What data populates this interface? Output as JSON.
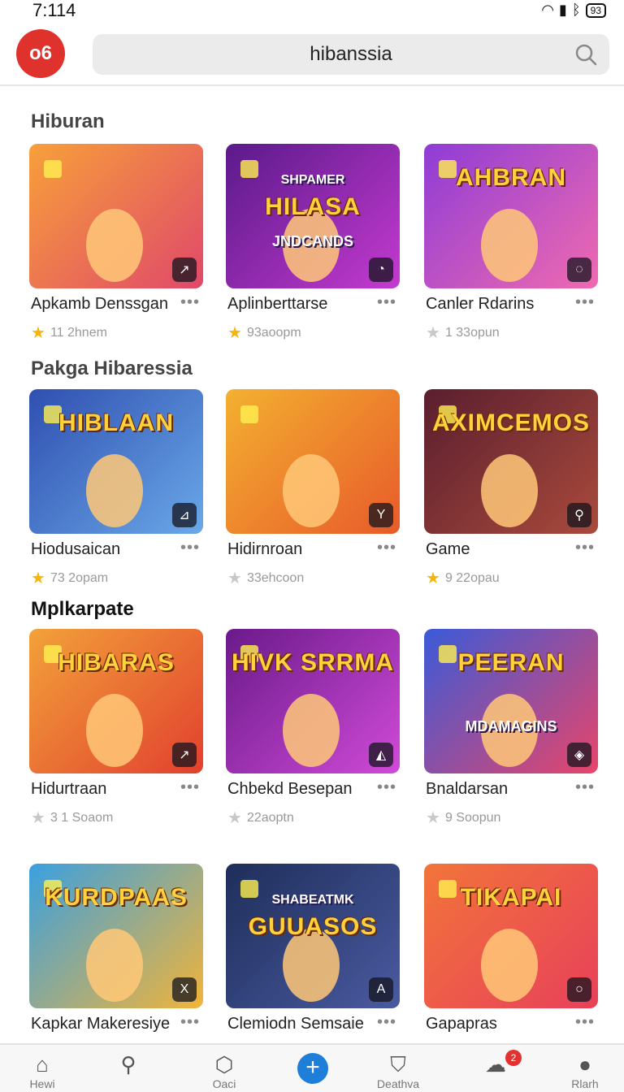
{
  "status": {
    "time": "7:114",
    "battery": "93"
  },
  "header": {
    "logo_text": "o6",
    "search_value": "hibanssia"
  },
  "sections": [
    {
      "title": "Hiburan"
    },
    {
      "title": "Pakga Hibaressia"
    },
    {
      "title": "Mplkarpate"
    }
  ],
  "cards": [
    {
      "name": "Apkamb Denssgan",
      "rating": "11 2hnem",
      "star": "gold",
      "thumb_title": "",
      "thumb_sub": "",
      "badge": "↗",
      "colors": [
        "#f7a03a",
        "#e0486a"
      ]
    },
    {
      "name": "Aplinberttarse",
      "rating": "93aoopm",
      "star": "gold",
      "thumb_title": "HILASA",
      "thumb_sub": "JNDCANDS",
      "thumb_top": "SHPAMER",
      "badge": "◔",
      "colors": [
        "#5a1a8a",
        "#c43ad0"
      ]
    },
    {
      "name": "Canler Rdarins",
      "rating": "1 33opun",
      "star": "gray",
      "thumb_title": "AHBRAN",
      "thumb_sub": "",
      "badge": "◌",
      "colors": [
        "#8e3cd6",
        "#f06ab0"
      ]
    },
    {
      "name": "Hiodusaican",
      "rating": "73 2opam",
      "star": "gold",
      "thumb_title": "HIBLAAN",
      "thumb_sub": "",
      "badge": "⊿",
      "colors": [
        "#2f4fb0",
        "#6aa8e8"
      ]
    },
    {
      "name": "Hidirnroan",
      "rating": "33ehcoon",
      "star": "gray",
      "thumb_title": "",
      "thumb_sub": "",
      "badge": "Y",
      "colors": [
        "#f3b130",
        "#e85a2a"
      ]
    },
    {
      "name": "Game",
      "rating": "9 22opau",
      "star": "gold",
      "thumb_title": "AXIMCEMOS",
      "thumb_sub": "",
      "badge": "⚲",
      "colors": [
        "#5a1e2e",
        "#a94a3c"
      ]
    },
    {
      "name": "Hidurtraan",
      "rating": "3 1 Soaom",
      "star": "gray",
      "thumb_title": "HIBARAS",
      "thumb_sub": "",
      "badge": "↗",
      "colors": [
        "#f2a23a",
        "#e2402e"
      ]
    },
    {
      "name": "Chbekd Besepan",
      "rating": "22aoptn",
      "star": "gray",
      "thumb_title": "HIVK SRRMA",
      "thumb_sub": "",
      "badge": "◭",
      "colors": [
        "#6a1a8a",
        "#d04ad8"
      ]
    },
    {
      "name": "Bnaldarsan",
      "rating": "9 Soopun",
      "star": "gray",
      "thumb_title": "PEERAN",
      "thumb_sub": "MDAMAGINS",
      "badge": "◈",
      "colors": [
        "#3a5ad8",
        "#e8456a"
      ]
    },
    {
      "name": "Kapkar Makeresiye",
      "rating": "",
      "star": "",
      "thumb_title": "KURDPAAS",
      "thumb_sub": "",
      "badge": "X",
      "colors": [
        "#3aa0e0",
        "#f2b43a"
      ]
    },
    {
      "name": "Clemiodn Semsaie",
      "rating": "",
      "star": "",
      "thumb_title": "GUUASOS",
      "thumb_top": "SHABEATMK",
      "thumb_sub": "",
      "badge": "A",
      "colors": [
        "#1e2e5a",
        "#4a5aa0"
      ]
    },
    {
      "name": "Gapapras",
      "rating": "",
      "star": "",
      "thumb_title": "TIKAPAI",
      "thumb_sub": "",
      "badge": "○",
      "colors": [
        "#f2743a",
        "#e8405a"
      ]
    }
  ],
  "nav": [
    {
      "label": "Hewi",
      "icon": "home-icon"
    },
    {
      "label": "",
      "icon": "search-icon"
    },
    {
      "label": "Oaci",
      "icon": "bag-icon"
    },
    {
      "label": "",
      "icon": "plus-icon"
    },
    {
      "label": "Deathva",
      "icon": "shield-icon"
    },
    {
      "label": "",
      "icon": "notification-icon",
      "badge": "2"
    },
    {
      "label": "Rlarh",
      "icon": "profile-icon"
    }
  ]
}
